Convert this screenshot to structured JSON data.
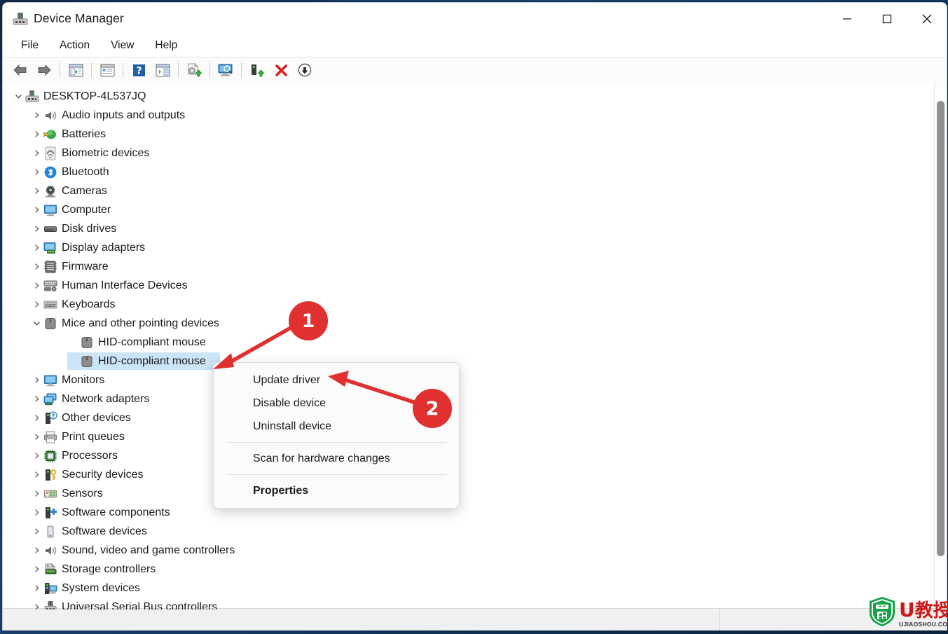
{
  "window": {
    "title": "Device Manager",
    "title_icon": "device-manager-icon",
    "controls": [
      {
        "name": "minimize-button",
        "glyph": "minimize-icon"
      },
      {
        "name": "maximize-button",
        "glyph": "maximize-icon"
      },
      {
        "name": "close-button",
        "glyph": "close-icon"
      }
    ]
  },
  "menubar": {
    "items": [
      {
        "label": "File",
        "name": "menu-file"
      },
      {
        "label": "Action",
        "name": "menu-action"
      },
      {
        "label": "View",
        "name": "menu-view"
      },
      {
        "label": "Help",
        "name": "menu-help"
      }
    ]
  },
  "toolbar": {
    "buttons": [
      {
        "name": "back-button",
        "icon": "back-arrow-icon"
      },
      {
        "name": "forward-button",
        "icon": "forward-arrow-icon"
      },
      {
        "name": "separator-1",
        "icon": "separator"
      },
      {
        "name": "show-hide-console-tree-button",
        "icon": "console-tree-icon"
      },
      {
        "name": "separator-2",
        "icon": "separator"
      },
      {
        "name": "properties-button",
        "icon": "properties-icon"
      },
      {
        "name": "separator-3",
        "icon": "separator"
      },
      {
        "name": "help-button",
        "icon": "help-question-icon"
      },
      {
        "name": "show-hide-action-pane-button",
        "icon": "action-pane-icon"
      },
      {
        "name": "separator-4",
        "icon": "separator"
      },
      {
        "name": "update-driver-button",
        "icon": "update-driver-icon"
      },
      {
        "name": "separator-5",
        "icon": "separator"
      },
      {
        "name": "scan-hardware-changes-button",
        "icon": "scan-hardware-icon"
      },
      {
        "name": "separator-6",
        "icon": "separator"
      },
      {
        "name": "enable-device-button",
        "icon": "enable-device-icon"
      },
      {
        "name": "uninstall-device-button",
        "icon": "uninstall-red-x-icon"
      },
      {
        "name": "disable-device-button",
        "icon": "disable-device-down-arrow-icon"
      }
    ]
  },
  "tree": {
    "nodes": [
      {
        "label": "DESKTOP-4L537JQ",
        "depth": 0,
        "expanded": true,
        "icon": "computer-root-icon",
        "selected": false
      },
      {
        "label": "Audio inputs and outputs",
        "depth": 1,
        "expanded": false,
        "icon": "speaker-icon",
        "selected": false
      },
      {
        "label": "Batteries",
        "depth": 1,
        "expanded": false,
        "icon": "battery-icon",
        "selected": false
      },
      {
        "label": "Biometric devices",
        "depth": 1,
        "expanded": false,
        "icon": "fingerprint-icon",
        "selected": false
      },
      {
        "label": "Bluetooth",
        "depth": 1,
        "expanded": false,
        "icon": "bluetooth-icon",
        "selected": false
      },
      {
        "label": "Cameras",
        "depth": 1,
        "expanded": false,
        "icon": "camera-icon",
        "selected": false
      },
      {
        "label": "Computer",
        "depth": 1,
        "expanded": false,
        "icon": "monitor-icon",
        "selected": false
      },
      {
        "label": "Disk drives",
        "depth": 1,
        "expanded": false,
        "icon": "disk-drive-icon",
        "selected": false
      },
      {
        "label": "Display adapters",
        "depth": 1,
        "expanded": false,
        "icon": "display-adapter-icon",
        "selected": false
      },
      {
        "label": "Firmware",
        "depth": 1,
        "expanded": false,
        "icon": "firmware-chip-icon",
        "selected": false
      },
      {
        "label": "Human Interface Devices",
        "depth": 1,
        "expanded": false,
        "icon": "hid-gamepad-icon",
        "selected": false
      },
      {
        "label": "Keyboards",
        "depth": 1,
        "expanded": false,
        "icon": "keyboard-icon",
        "selected": false
      },
      {
        "label": "Mice and other pointing devices",
        "depth": 1,
        "expanded": true,
        "icon": "mouse-icon",
        "selected": false
      },
      {
        "label": "HID-compliant mouse",
        "depth": 2,
        "expanded": null,
        "icon": "mouse-icon",
        "selected": false
      },
      {
        "label": "HID-compliant mouse",
        "depth": 2,
        "expanded": null,
        "icon": "mouse-icon",
        "selected": true
      },
      {
        "label": "Monitors",
        "depth": 1,
        "expanded": false,
        "icon": "monitor-icon",
        "selected": false
      },
      {
        "label": "Network adapters",
        "depth": 1,
        "expanded": false,
        "icon": "network-adapter-icon",
        "selected": false
      },
      {
        "label": "Other devices",
        "depth": 1,
        "expanded": false,
        "icon": "other-device-question-icon",
        "selected": false
      },
      {
        "label": "Print queues",
        "depth": 1,
        "expanded": false,
        "icon": "printer-icon",
        "selected": false
      },
      {
        "label": "Processors",
        "depth": 1,
        "expanded": false,
        "icon": "processor-chip-icon",
        "selected": false
      },
      {
        "label": "Security devices",
        "depth": 1,
        "expanded": false,
        "icon": "security-key-icon",
        "selected": false
      },
      {
        "label": "Sensors",
        "depth": 1,
        "expanded": false,
        "icon": "sensor-icon",
        "selected": false
      },
      {
        "label": "Software components",
        "depth": 1,
        "expanded": false,
        "icon": "software-component-icon",
        "selected": false
      },
      {
        "label": "Software devices",
        "depth": 1,
        "expanded": false,
        "icon": "software-device-icon",
        "selected": false
      },
      {
        "label": "Sound, video and game controllers",
        "depth": 1,
        "expanded": false,
        "icon": "speaker-icon",
        "selected": false
      },
      {
        "label": "Storage controllers",
        "depth": 1,
        "expanded": false,
        "icon": "storage-controller-icon",
        "selected": false
      },
      {
        "label": "System devices",
        "depth": 1,
        "expanded": false,
        "icon": "system-device-icon",
        "selected": false
      },
      {
        "label": "Universal Serial Bus controllers",
        "depth": 1,
        "expanded": false,
        "icon": "usb-controller-icon",
        "selected": false
      }
    ],
    "chevron_collapsed": "›",
    "chevron_expanded": "⌄"
  },
  "context_menu": {
    "items": [
      {
        "label": "Update driver",
        "name": "ctx-update-driver",
        "bold": false,
        "separator_after": false
      },
      {
        "label": "Disable device",
        "name": "ctx-disable-device",
        "bold": false,
        "separator_after": false
      },
      {
        "label": "Uninstall device",
        "name": "ctx-uninstall-device",
        "bold": false,
        "separator_after": true
      },
      {
        "label": "Scan for hardware changes",
        "name": "ctx-scan-hardware-changes",
        "bold": false,
        "separator_after": true
      },
      {
        "label": "Properties",
        "name": "ctx-properties",
        "bold": true,
        "separator_after": false
      }
    ]
  },
  "annotations": {
    "badge_one": "1",
    "badge_two": "2",
    "color": "#e03030"
  },
  "watermark": {
    "letter": "U",
    "chinese": "教授",
    "domain": "UJIAOSHOU.COM"
  },
  "statusbar": {
    "text": ""
  },
  "colors": {
    "selection": "#cce4f7",
    "accent_red": "#e03030",
    "window_bg": "#ffffff"
  }
}
